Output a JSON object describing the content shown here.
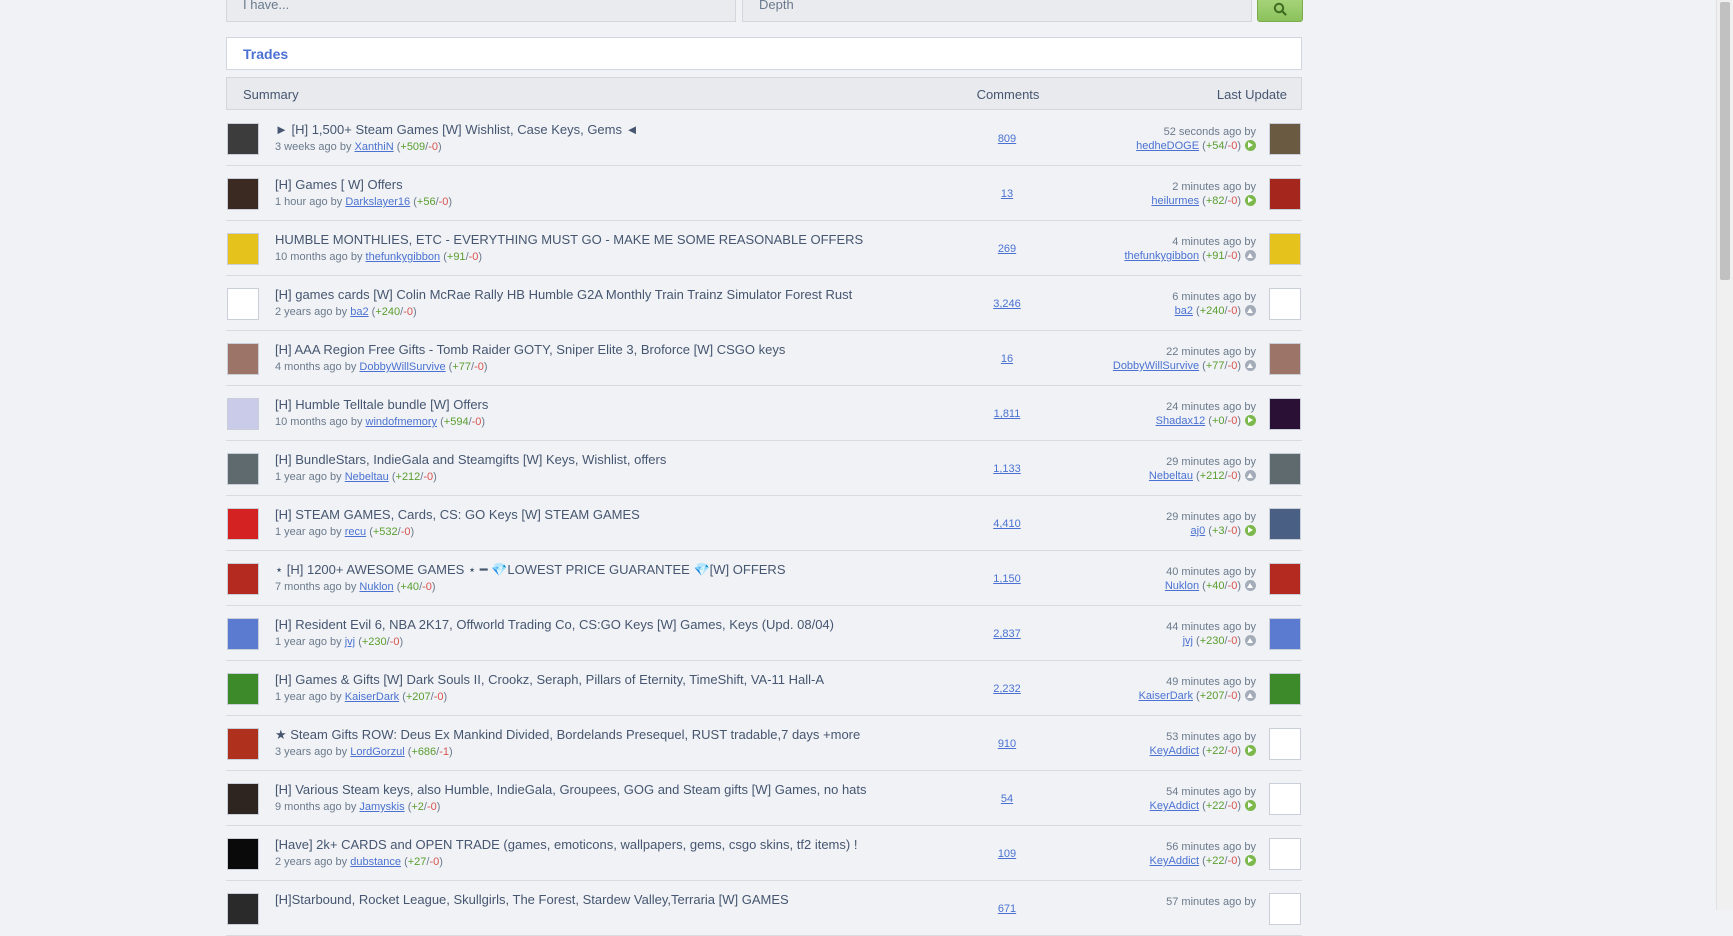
{
  "search": {
    "have_placeholder": "I have...",
    "want_placeholder": "Depth",
    "button_icon": "search-icon"
  },
  "panel": {
    "title": "Trades"
  },
  "table": {
    "columns": {
      "summary": "Summary",
      "comments": "Comments",
      "last_update": "Last Update"
    }
  },
  "rows": [
    {
      "title": "► [H] 1,500+ Steam Games [W] Wishlist, Case Keys, Gems ◄",
      "age": "3 weeks ago",
      "by": "by",
      "author": "XanthiN",
      "rep_pos": "+509",
      "rep_neg": "-0",
      "comments": "809",
      "update_time": "52 seconds ago by",
      "updater": "hedheDOGE",
      "up_pos": "+54",
      "up_neg": "-0",
      "status": "online",
      "avatar_color": "#3c3c3c",
      "avatar2_color": "#6b5a42"
    },
    {
      "title": "[H] Games [ W] Offers",
      "age": "1 hour ago",
      "by": "by",
      "author": "Darkslayer16",
      "rep_pos": "+56",
      "rep_neg": "-0",
      "comments": "13",
      "update_time": "2 minutes ago by",
      "updater": "heilurmes",
      "up_pos": "+82",
      "up_neg": "-0",
      "status": "online",
      "avatar_color": "#3b2a22",
      "avatar2_color": "#a5261c"
    },
    {
      "title": "HUMBLE MONTHLIES, ETC - EVERYTHING MUST GO - MAKE ME SOME REASONABLE OFFERS",
      "age": "10 months ago",
      "by": "by",
      "author": "thefunkygibbon",
      "rep_pos": "+91",
      "rep_neg": "-0",
      "comments": "269",
      "update_time": "4 minutes ago by",
      "updater": "thefunkygibbon",
      "up_pos": "+91",
      "up_neg": "-0",
      "status": "offline",
      "avatar_color": "#e6c21c",
      "avatar2_color": "#e6c21c"
    },
    {
      "title": "[H] games cards [W] Colin McRae Rally HB Humble G2A Monthly Train Trainz Simulator Forest Rust",
      "age": "2 years ago",
      "by": "by",
      "author": "ba2",
      "rep_pos": "+240",
      "rep_neg": "-0",
      "comments": "3,246",
      "update_time": "6 minutes ago by",
      "updater": "ba2",
      "up_pos": "+240",
      "up_neg": "-0",
      "status": "offline",
      "avatar_color": "#ffffff",
      "avatar2_color": "#ffffff"
    },
    {
      "title": "[H] AAA Region Free Gifts - Tomb Raider GOTY, Sniper Elite 3, Broforce [W] CSGO keys",
      "age": "4 months ago",
      "by": "by",
      "author": "DobbyWillSurvive",
      "rep_pos": "+77",
      "rep_neg": "-0",
      "comments": "16",
      "update_time": "22 minutes ago by",
      "updater": "DobbyWillSurvive",
      "up_pos": "+77",
      "up_neg": "-0",
      "status": "offline",
      "avatar_color": "#9c7468",
      "avatar2_color": "#9c7468"
    },
    {
      "title": "[H] Humble Telltale bundle [W] Offers",
      "age": "10 months ago",
      "by": "by",
      "author": "windofmemory",
      "rep_pos": "+594",
      "rep_neg": "-0",
      "comments": "1,811",
      "update_time": "24 minutes ago by",
      "updater": "Shadax12",
      "up_pos": "+0",
      "up_neg": "-0",
      "status": "online",
      "avatar_color": "#c9cbe8",
      "avatar2_color": "#2a1034"
    },
    {
      "title": "[H] BundleStars, IndieGala and Steamgifts [W] Keys, Wishlist, offers",
      "age": "1 year ago",
      "by": "by",
      "author": "Nebeltau",
      "rep_pos": "+212",
      "rep_neg": "-0",
      "comments": "1,133",
      "update_time": "29 minutes ago by",
      "updater": "Nebeltau",
      "up_pos": "+212",
      "up_neg": "-0",
      "status": "offline",
      "avatar_color": "#5e6a6e",
      "avatar2_color": "#5e6a6e"
    },
    {
      "title": "[H] STEAM GAMES, Cards, CS: GO Keys [W] STEAM GAMES",
      "age": "1 year ago",
      "by": "by",
      "author": "recu",
      "rep_pos": "+532",
      "rep_neg": "-0",
      "comments": "4,410",
      "update_time": "29 minutes ago by",
      "updater": "aj0",
      "up_pos": "+3",
      "up_neg": "-0",
      "status": "online",
      "avatar_color": "#d42121",
      "avatar2_color": "#4a5f84"
    },
    {
      "title": "⋆ [H] 1200+ AWESOME GAMES ⋆ ━ 💎LOWEST PRICE GUARANTEE 💎[W] OFFERS",
      "age": "7 months ago",
      "by": "by",
      "author": "Nuklon",
      "rep_pos": "+40",
      "rep_neg": "-0",
      "comments": "1,150",
      "update_time": "40 minutes ago by",
      "updater": "Nuklon",
      "up_pos": "+40",
      "up_neg": "-0",
      "status": "offline",
      "avatar_color": "#b52a20",
      "avatar2_color": "#b52a20"
    },
    {
      "title": "[H] Resident Evil 6, NBA 2K17, Offworld Trading Co, CS:GO Keys [W] Games, Keys (Upd. 08/04)",
      "age": "1 year ago",
      "by": "by",
      "author": "jvj",
      "rep_pos": "+230",
      "rep_neg": "-0",
      "comments": "2,837",
      "update_time": "44 minutes ago by",
      "updater": "jvj",
      "up_pos": "+230",
      "up_neg": "-0",
      "status": "offline",
      "avatar_color": "#5b7bd0",
      "avatar2_color": "#5b7bd0"
    },
    {
      "title": "[H] Games & Gifts [W] Dark Souls II, Crookz, Seraph, Pillars of Eternity, TimeShift, VA-11 Hall-A",
      "age": "1 year ago",
      "by": "by",
      "author": "KaiserDark",
      "rep_pos": "+207",
      "rep_neg": "-0",
      "comments": "2,232",
      "update_time": "49 minutes ago by",
      "updater": "KaiserDark",
      "up_pos": "+207",
      "up_neg": "-0",
      "status": "offline",
      "avatar_color": "#3d8a2a",
      "avatar2_color": "#3d8a2a"
    },
    {
      "title": "★ Steam Gifts ROW: Deus Ex Mankind Divided, Bordelands Presequel, RUST tradable,7 days +more",
      "age": "3 years ago",
      "by": "by",
      "author": "LordGorzul",
      "rep_pos": "+686",
      "rep_neg": "-1",
      "comments": "910",
      "update_time": "53 minutes ago by",
      "updater": "KeyAddict",
      "up_pos": "+22",
      "up_neg": "-0",
      "status": "online",
      "avatar_color": "#b0301e",
      "avatar2_color": "#ffffff"
    },
    {
      "title": "[H] Various Steam keys, also Humble, IndieGala, Groupees, GOG and Steam gifts [W] Games, no hats",
      "age": "9 months ago",
      "by": "by",
      "author": "Jamyskis",
      "rep_pos": "+2",
      "rep_neg": "-0",
      "comments": "54",
      "update_time": "54 minutes ago by",
      "updater": "KeyAddict",
      "up_pos": "+22",
      "up_neg": "-0",
      "status": "online",
      "avatar_color": "#2e2520",
      "avatar2_color": "#ffffff"
    },
    {
      "title": "[Have] 2k+ CARDS and OPEN TRADE (games, emoticons, wallpapers, gems, csgo skins, tf2 items) !",
      "age": "2 years ago",
      "by": "by",
      "author": "dubstance",
      "rep_pos": "+27",
      "rep_neg": "-0",
      "comments": "109",
      "update_time": "56 minutes ago by",
      "updater": "KeyAddict",
      "up_pos": "+22",
      "up_neg": "-0",
      "status": "online",
      "avatar_color": "#0a0a0a",
      "avatar2_color": "#ffffff"
    },
    {
      "title": "[H]Starbound, Rocket League, Skullgirls, The Forest, Stardew Valley,Terraria [W] GAMES",
      "age": "",
      "by": "",
      "author": "",
      "rep_pos": "",
      "rep_neg": "",
      "comments": "671",
      "update_time": "57 minutes ago by",
      "updater": "",
      "up_pos": "",
      "up_neg": "",
      "status": "online",
      "avatar_color": "#2a2a2a",
      "avatar2_color": "#ffffff"
    }
  ],
  "colors": {
    "accent": "#4b72d2",
    "positive": "#5a9e2f",
    "negative": "#d9534f",
    "button": "#8bc15c"
  }
}
